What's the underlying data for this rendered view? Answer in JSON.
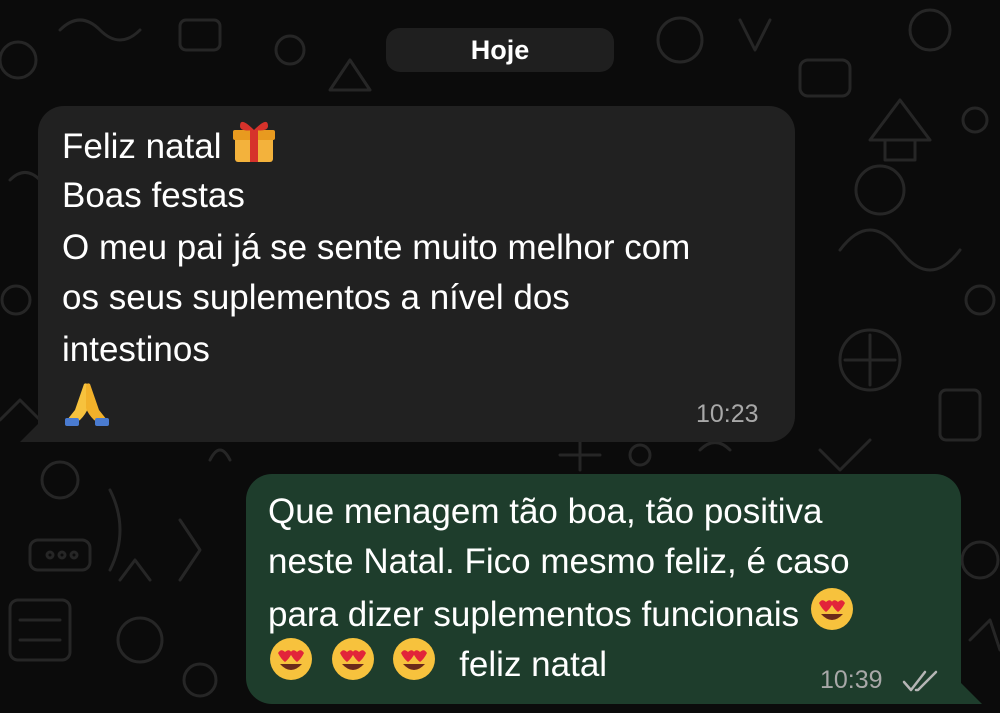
{
  "chat": {
    "date_chip": "Hoje",
    "incoming": {
      "lines": [
        "Feliz natal",
        "Boas festas",
        "O meu pai já se sente muito melhor com",
        "os seus suplementos a nível dos",
        "intestinos"
      ],
      "emojis": [
        "gift-emoji",
        "folded-hands-emoji"
      ],
      "time": "10:23"
    },
    "outgoing": {
      "lines": [
        "Que menagem tão boa, tão positiva",
        "neste Natal. Fico mesmo feliz, é caso",
        "para dizer suplementos funcionais",
        "feliz natal"
      ],
      "emojis": [
        "heart-eyes-emoji",
        "heart-eyes-emoji",
        "heart-eyes-emoji",
        "heart-eyes-emoji"
      ],
      "time": "10:39",
      "status_icon": "double-check-icon"
    }
  },
  "colors": {
    "background": "#0b0b0b",
    "incoming_bubble": "#212121",
    "outgoing_bubble": "#1e3d2c",
    "timestamp": "#a8a8a8"
  }
}
